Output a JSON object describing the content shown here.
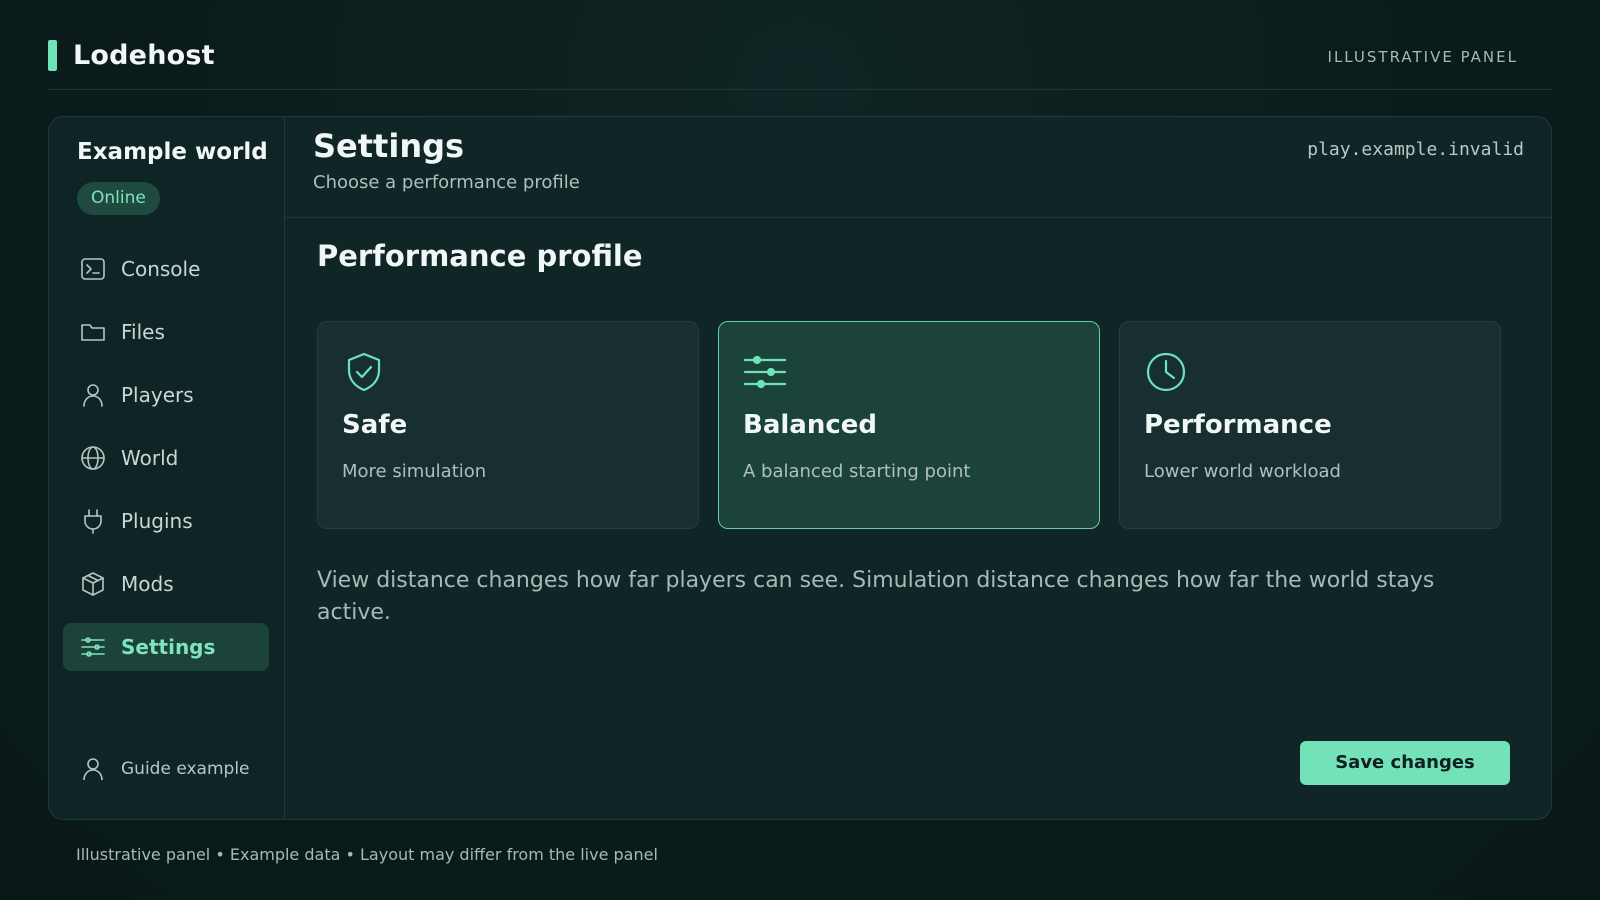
{
  "app": {
    "name": "Lodehost",
    "label": "ILLUSTRATIVE PANEL"
  },
  "sidebar": {
    "world_name": "Example world",
    "status": "Online",
    "items": [
      {
        "label": "Console",
        "icon": "terminal-icon",
        "active": false
      },
      {
        "label": "Files",
        "icon": "folder-icon",
        "active": false
      },
      {
        "label": "Players",
        "icon": "user-icon",
        "active": false
      },
      {
        "label": "World",
        "icon": "globe-icon",
        "active": false
      },
      {
        "label": "Plugins",
        "icon": "plug-icon",
        "active": false
      },
      {
        "label": "Mods",
        "icon": "box-icon",
        "active": false
      },
      {
        "label": "Settings",
        "icon": "sliders-icon",
        "active": true
      }
    ],
    "user": "Guide example"
  },
  "main": {
    "title": "Settings",
    "subtitle": "Choose a performance profile",
    "host": "play.example.invalid",
    "section_title": "Performance profile",
    "profiles": [
      {
        "title": "Safe",
        "description": "More simulation",
        "icon": "shield-check-icon",
        "selected": false
      },
      {
        "title": "Balanced",
        "description": "A balanced starting point",
        "icon": "sliders-icon",
        "selected": true
      },
      {
        "title": "Performance",
        "description": "Lower world workload",
        "icon": "clock-icon",
        "selected": false
      }
    ],
    "description": "View distance changes how far players can see. Simulation distance changes how far the world stays active.",
    "save_label": "Save changes"
  },
  "footer": {
    "note": "Illustrative panel • Example data • Layout may differ from the live panel"
  },
  "colors": {
    "accent": "#74e2b9",
    "background": "#0b1b1b",
    "panel": "#0f2526",
    "selected": "#1c4339"
  }
}
